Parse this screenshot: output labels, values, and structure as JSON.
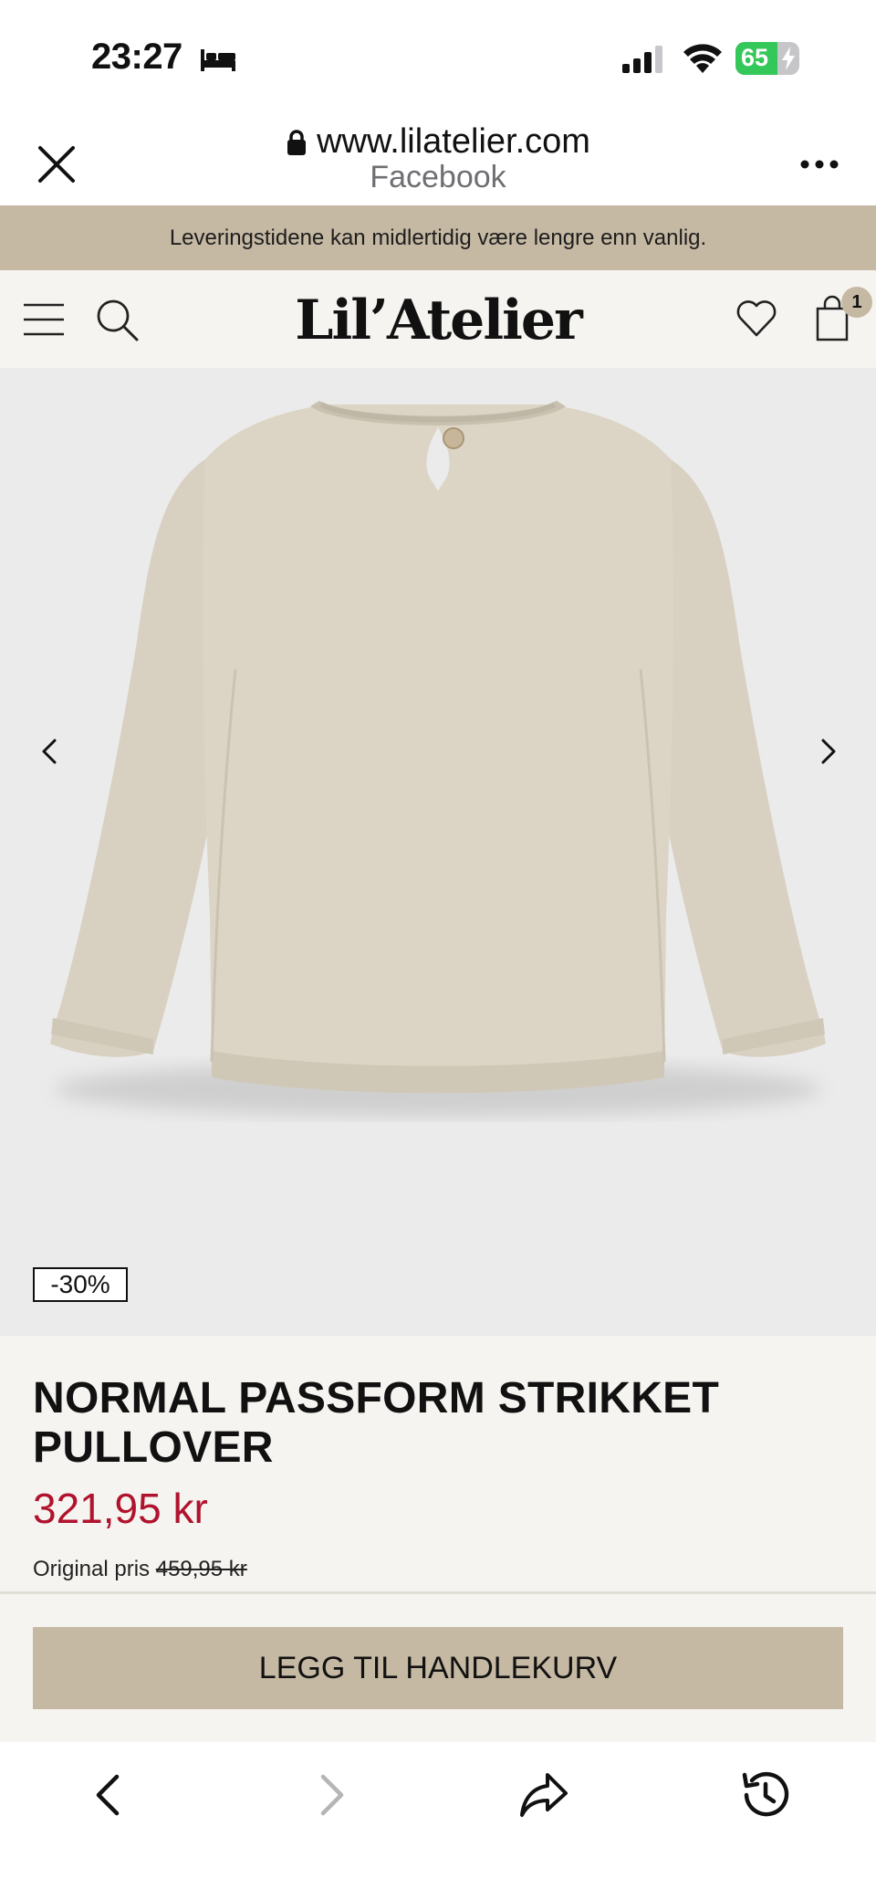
{
  "status_bar": {
    "time": "23:27",
    "battery_percent": "65",
    "battery_level": 0.65,
    "icons": [
      "bed-icon",
      "signal-icon",
      "wifi-icon",
      "battery-icon"
    ]
  },
  "browser": {
    "url": "www.lilatelier.com",
    "source": "Facebook",
    "icons": [
      "close-icon",
      "lock-icon",
      "more-icon"
    ]
  },
  "notice": {
    "text": "Leveringstidene kan midlertidig være lengre enn vanlig."
  },
  "site_header": {
    "logo": "Lil’Atelier",
    "cart_count": "1",
    "icons": [
      "menu-icon",
      "search-icon",
      "heart-icon",
      "shopping-bag-icon"
    ]
  },
  "product": {
    "discount": "-30%",
    "title": "NORMAL PASSFORM STRIKKET PULLOVER",
    "price": "321,95 kr",
    "original_label": "Original pris",
    "original_price": "459,95 kr",
    "add_to_cart": "LEGG TIL HANDLEKURV"
  },
  "colors": {
    "accent_beige": "#c6b9a3",
    "price_red": "#b0132e",
    "background_cream": "#f6f4f0",
    "image_background": "#ebebeb",
    "battery_green": "#34c759"
  },
  "toolbar": {
    "icons": [
      "back-arrow-icon",
      "forward-arrow-icon",
      "share-icon",
      "history-icon"
    ],
    "forward_enabled": false
  }
}
